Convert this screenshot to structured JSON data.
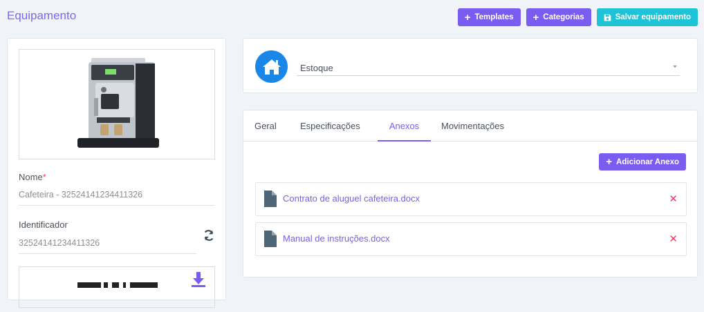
{
  "page": {
    "title": "Equipamento"
  },
  "toolbar": {
    "templates_label": "Templates",
    "categorias_label": "Categorias",
    "salvar_label": "Salvar equipamento"
  },
  "equipment": {
    "nome_label": "Nome",
    "nome_required_mark": "*",
    "nome_value": "Cafeteira - 32524141234411326",
    "identificador_label": "Identificador",
    "identificador_value": "32524141234411326"
  },
  "stock": {
    "selected": "Estoque"
  },
  "tabs": [
    {
      "label": "Geral"
    },
    {
      "label": "Especificações"
    },
    {
      "label": "Anexos"
    },
    {
      "label": "Movimentações"
    }
  ],
  "active_tab": "Anexos",
  "attachments": {
    "add_label": "Adicionar Anexo",
    "files": [
      {
        "name": "Contrato de aluguel cafeteira.docx"
      },
      {
        "name": "Manual de instruções.docx"
      }
    ]
  },
  "colors": {
    "accent": "#7b5cf0",
    "teal": "#1ec3d8",
    "home_blue": "#1a86e8",
    "delete_red": "#e83e5c"
  },
  "icons": [
    "plus-icon",
    "save-icon",
    "home-icon",
    "refresh-icon",
    "download-icon",
    "file-icon",
    "close-icon",
    "chevron-down-icon"
  ]
}
